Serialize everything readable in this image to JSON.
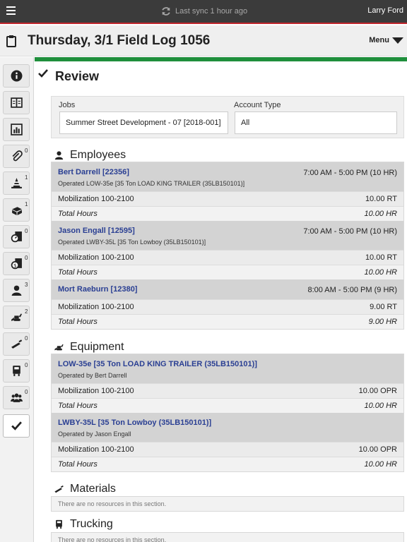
{
  "topbar": {
    "sync_text": "Last sync 1 hour ago",
    "user": "Larry Ford"
  },
  "title": {
    "text": "Thursday, 3/1 Field Log 1056",
    "menu_label": "Menu"
  },
  "sidebar": {
    "items": [
      {
        "icon": "info-icon",
        "badge": ""
      },
      {
        "icon": "book-icon",
        "badge": ""
      },
      {
        "icon": "chart-icon",
        "badge": ""
      },
      {
        "icon": "paperclip-icon",
        "badge": "0"
      },
      {
        "icon": "cone-icon",
        "badge": "1"
      },
      {
        "icon": "material-box-icon",
        "badge": "1"
      },
      {
        "icon": "meter-icon",
        "badge": "0"
      },
      {
        "icon": "money-icon",
        "badge": "0"
      },
      {
        "icon": "person-icon",
        "badge": "3"
      },
      {
        "icon": "excavator-icon",
        "badge": "2"
      },
      {
        "icon": "trowel-icon",
        "badge": "0"
      },
      {
        "icon": "truck-icon",
        "badge": "0"
      },
      {
        "icon": "group-icon",
        "badge": "0"
      },
      {
        "icon": "check-icon",
        "badge": ""
      }
    ]
  },
  "review": {
    "title": "Review"
  },
  "filters": {
    "jobs_label": "Jobs",
    "jobs_value": "Summer Street Development - 07 [2018-001]",
    "account_label": "Account Type",
    "account_value": "All"
  },
  "employees": {
    "heading": "Employees",
    "items": [
      {
        "name": "Bert Darrell [22356]",
        "sub": "Operated LOW-35e [35 Ton LOAD KING TRAILER (35LB150101)]",
        "time": "7:00 AM - 5:00 PM (10 HR)",
        "line_label": "Mobilization 100-2100",
        "line_value": "10.00 RT",
        "total_label": "Total Hours",
        "total_value": "10.00 HR"
      },
      {
        "name": "Jason Engall [12595]",
        "sub": "Operated LWBY-35L [35 Ton Lowboy (35LB150101)]",
        "time": "7:00 AM - 5:00 PM (10 HR)",
        "line_label": "Mobilization 100-2100",
        "line_value": "10.00 RT",
        "total_label": "Total Hours",
        "total_value": "10.00 HR"
      },
      {
        "name": "Mort Raeburn [12380]",
        "sub": "",
        "time": "8:00 AM - 5:00 PM (9 HR)",
        "line_label": "Mobilization 100-2100",
        "line_value": "9.00 RT",
        "total_label": "Total Hours",
        "total_value": "9.00 HR"
      }
    ]
  },
  "equipment": {
    "heading": "Equipment",
    "items": [
      {
        "name": "LOW-35e [35 Ton LOAD KING TRAILER (35LB150101)]",
        "sub": "Operated by Bert Darrell",
        "line_label": "Mobilization 100-2100",
        "line_value": "10.00 OPR",
        "total_label": "Total Hours",
        "total_value": "10.00 HR"
      },
      {
        "name": "LWBY-35L [35 Ton Lowboy (35LB150101)]",
        "sub": "Operated by Jason Engall",
        "line_label": "Mobilization 100-2100",
        "line_value": "10.00 OPR",
        "total_label": "Total Hours",
        "total_value": "10.00 HR"
      }
    ]
  },
  "materials": {
    "heading": "Materials",
    "empty": "There are no resources in this section."
  },
  "trucking": {
    "heading": "Trucking",
    "empty": "There are no resources in this section."
  }
}
